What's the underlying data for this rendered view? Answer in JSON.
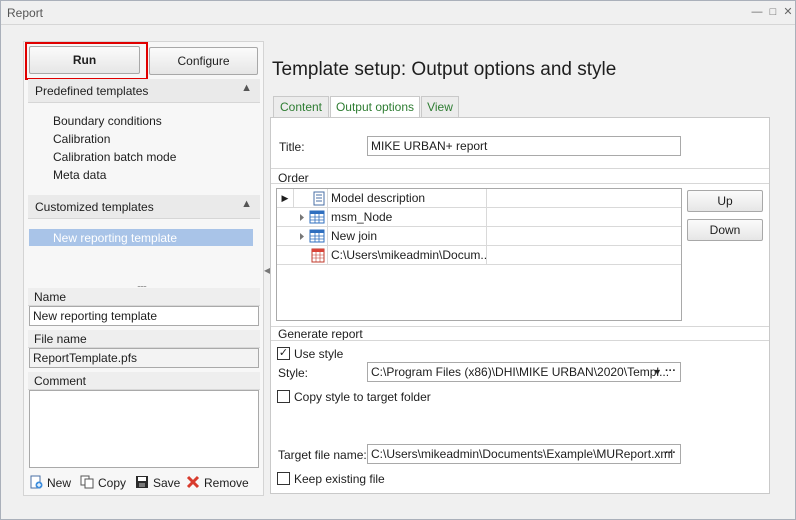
{
  "window": {
    "title": "Report"
  },
  "left": {
    "run_label": "Run",
    "configure_label": "Configure",
    "predefined": {
      "header": "Predefined templates",
      "items": [
        "Boundary conditions",
        "Calibration",
        "Calibration batch mode",
        "Meta data"
      ]
    },
    "customized": {
      "header": "Customized templates",
      "items": [
        "New reporting template"
      ]
    },
    "grip": "......",
    "name_label": "Name",
    "name_value": "New reporting template",
    "filename_label": "File name",
    "filename_value": "ReportTemplate.pfs",
    "comment_label": "Comment",
    "comment_value": "",
    "actions": {
      "new": "New",
      "copy": "Copy",
      "save": "Save",
      "remove": "Remove"
    }
  },
  "main": {
    "heading": "Template setup: Output options and style",
    "tabs": [
      "Content",
      "Output options",
      "View"
    ],
    "title_label": "Title:",
    "title_value": "MIKE URBAN+ report",
    "order": {
      "label": "Order",
      "rows": [
        {
          "text": "Model description",
          "icon": "document-icon"
        },
        {
          "text": "msm_Node",
          "icon": "table-icon"
        },
        {
          "text": "New join",
          "icon": "table-icon"
        },
        {
          "text": "C:\\Users\\mikeadmin\\Docum...",
          "icon": "calendar-table-icon"
        }
      ],
      "up_label": "Up",
      "down_label": "Down"
    },
    "generate": {
      "label": "Generate report",
      "use_style_label": "Use style",
      "use_style_checked": true,
      "style_label": "Style:",
      "style_value": "C:\\Program Files (x86)\\DHI\\MIKE URBAN\\2020\\Templ...",
      "copy_style_label": "Copy style to target folder",
      "copy_style_checked": false,
      "target_label": "Target file name:",
      "target_value": "C:\\Users\\mikeadmin\\Documents\\Example\\MUReport.xml",
      "keep_label": "Keep existing file",
      "keep_checked": false,
      "ellipsis": "···"
    }
  },
  "colors": {
    "tab_text": "#2e7d32",
    "selection": "#a9c4e8",
    "run_outline": "#e00000"
  }
}
